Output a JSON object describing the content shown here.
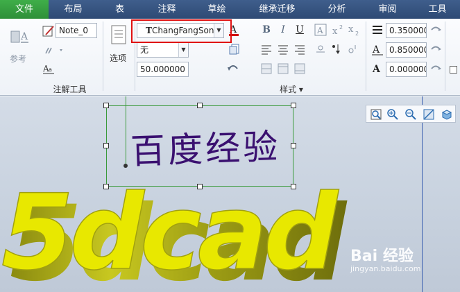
{
  "menu": {
    "items": [
      "文件",
      "布局",
      "表",
      "注释",
      "草绘",
      "继承迁移",
      "分析",
      "审阅",
      "工具"
    ],
    "active_index": 0
  },
  "ribbon": {
    "annotation_group": {
      "reference_label": "参考",
      "note_name": "Note_0",
      "group_label": "注解工具"
    },
    "options_label": "选项",
    "style_group": {
      "font_name": "ChangFangSong",
      "font_prefix": "T",
      "line_style": "无",
      "height_value": "50.000000",
      "group_label": "样式"
    },
    "format_values": {
      "line_spacing": "0.350000",
      "width_factor": "0.850000",
      "slant_angle": "0.000000"
    }
  },
  "canvas": {
    "note_text": "百度经验",
    "model_text": "5dcad"
  },
  "watermark": {
    "brand": "Bai 经验",
    "url": "jingyan.baidu.com"
  },
  "colors": {
    "menubar": "#2e4a74",
    "active_tab": "#3fae49",
    "highlight": "#e01010",
    "model_face": "#e8e800",
    "note_text": "#3a1070"
  }
}
